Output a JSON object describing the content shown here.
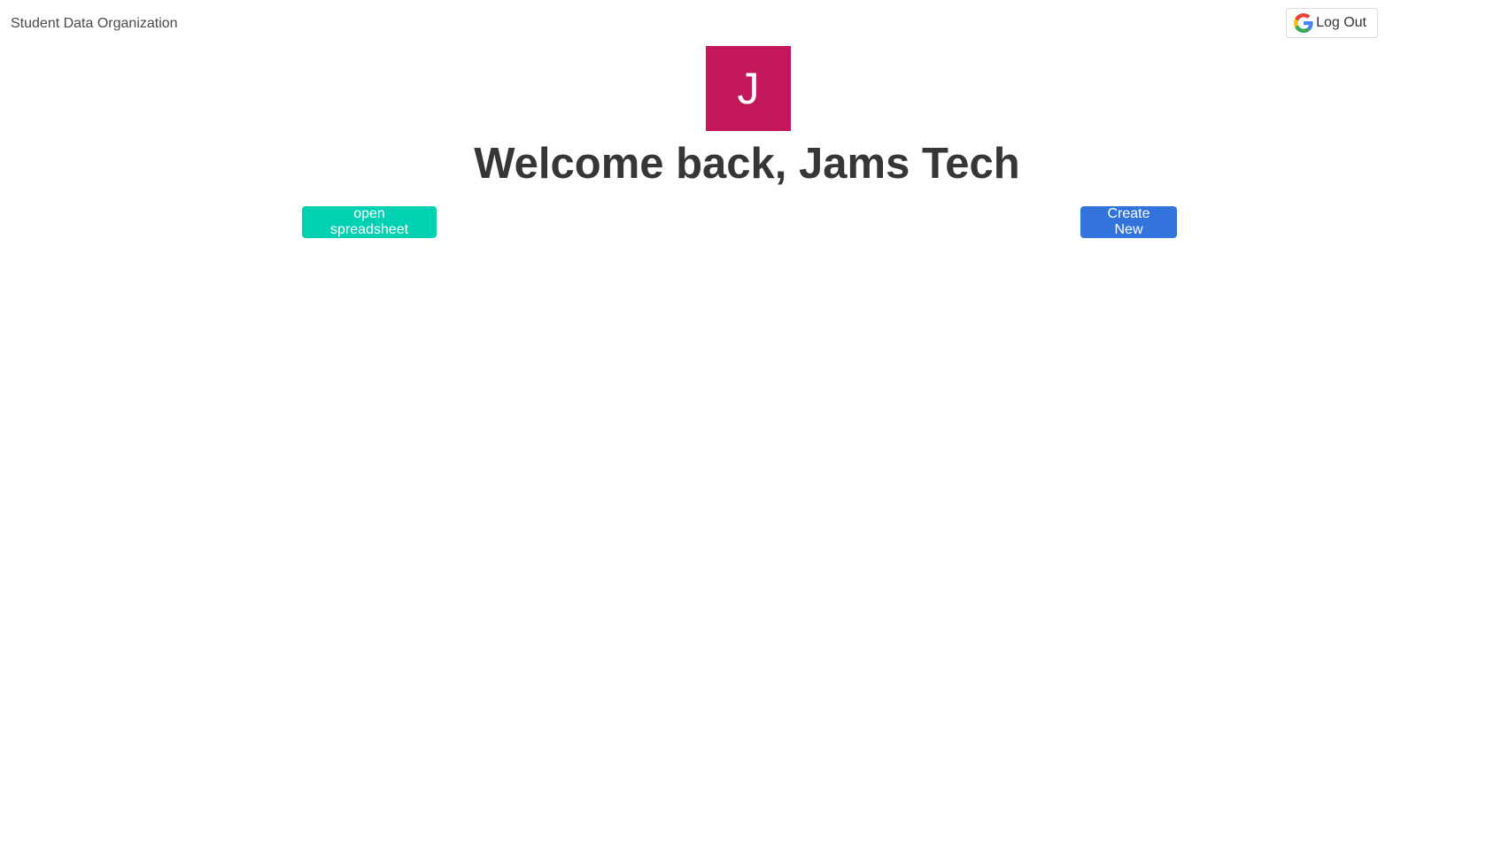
{
  "navbar": {
    "brand": "Student Data Organization",
    "logout_label": "Log Out",
    "logout_icon": "google-g-icon"
  },
  "profile": {
    "avatar_initial": "J",
    "avatar_color": "#c2185b"
  },
  "main": {
    "welcome_title": "Welcome back, Jams Tech",
    "open_spreadsheet_label": "open spreadsheet",
    "create_new_label": "Create New"
  },
  "colors": {
    "primary_teal": "#00d1b2",
    "primary_blue": "#3273dc",
    "text": "#363636"
  }
}
